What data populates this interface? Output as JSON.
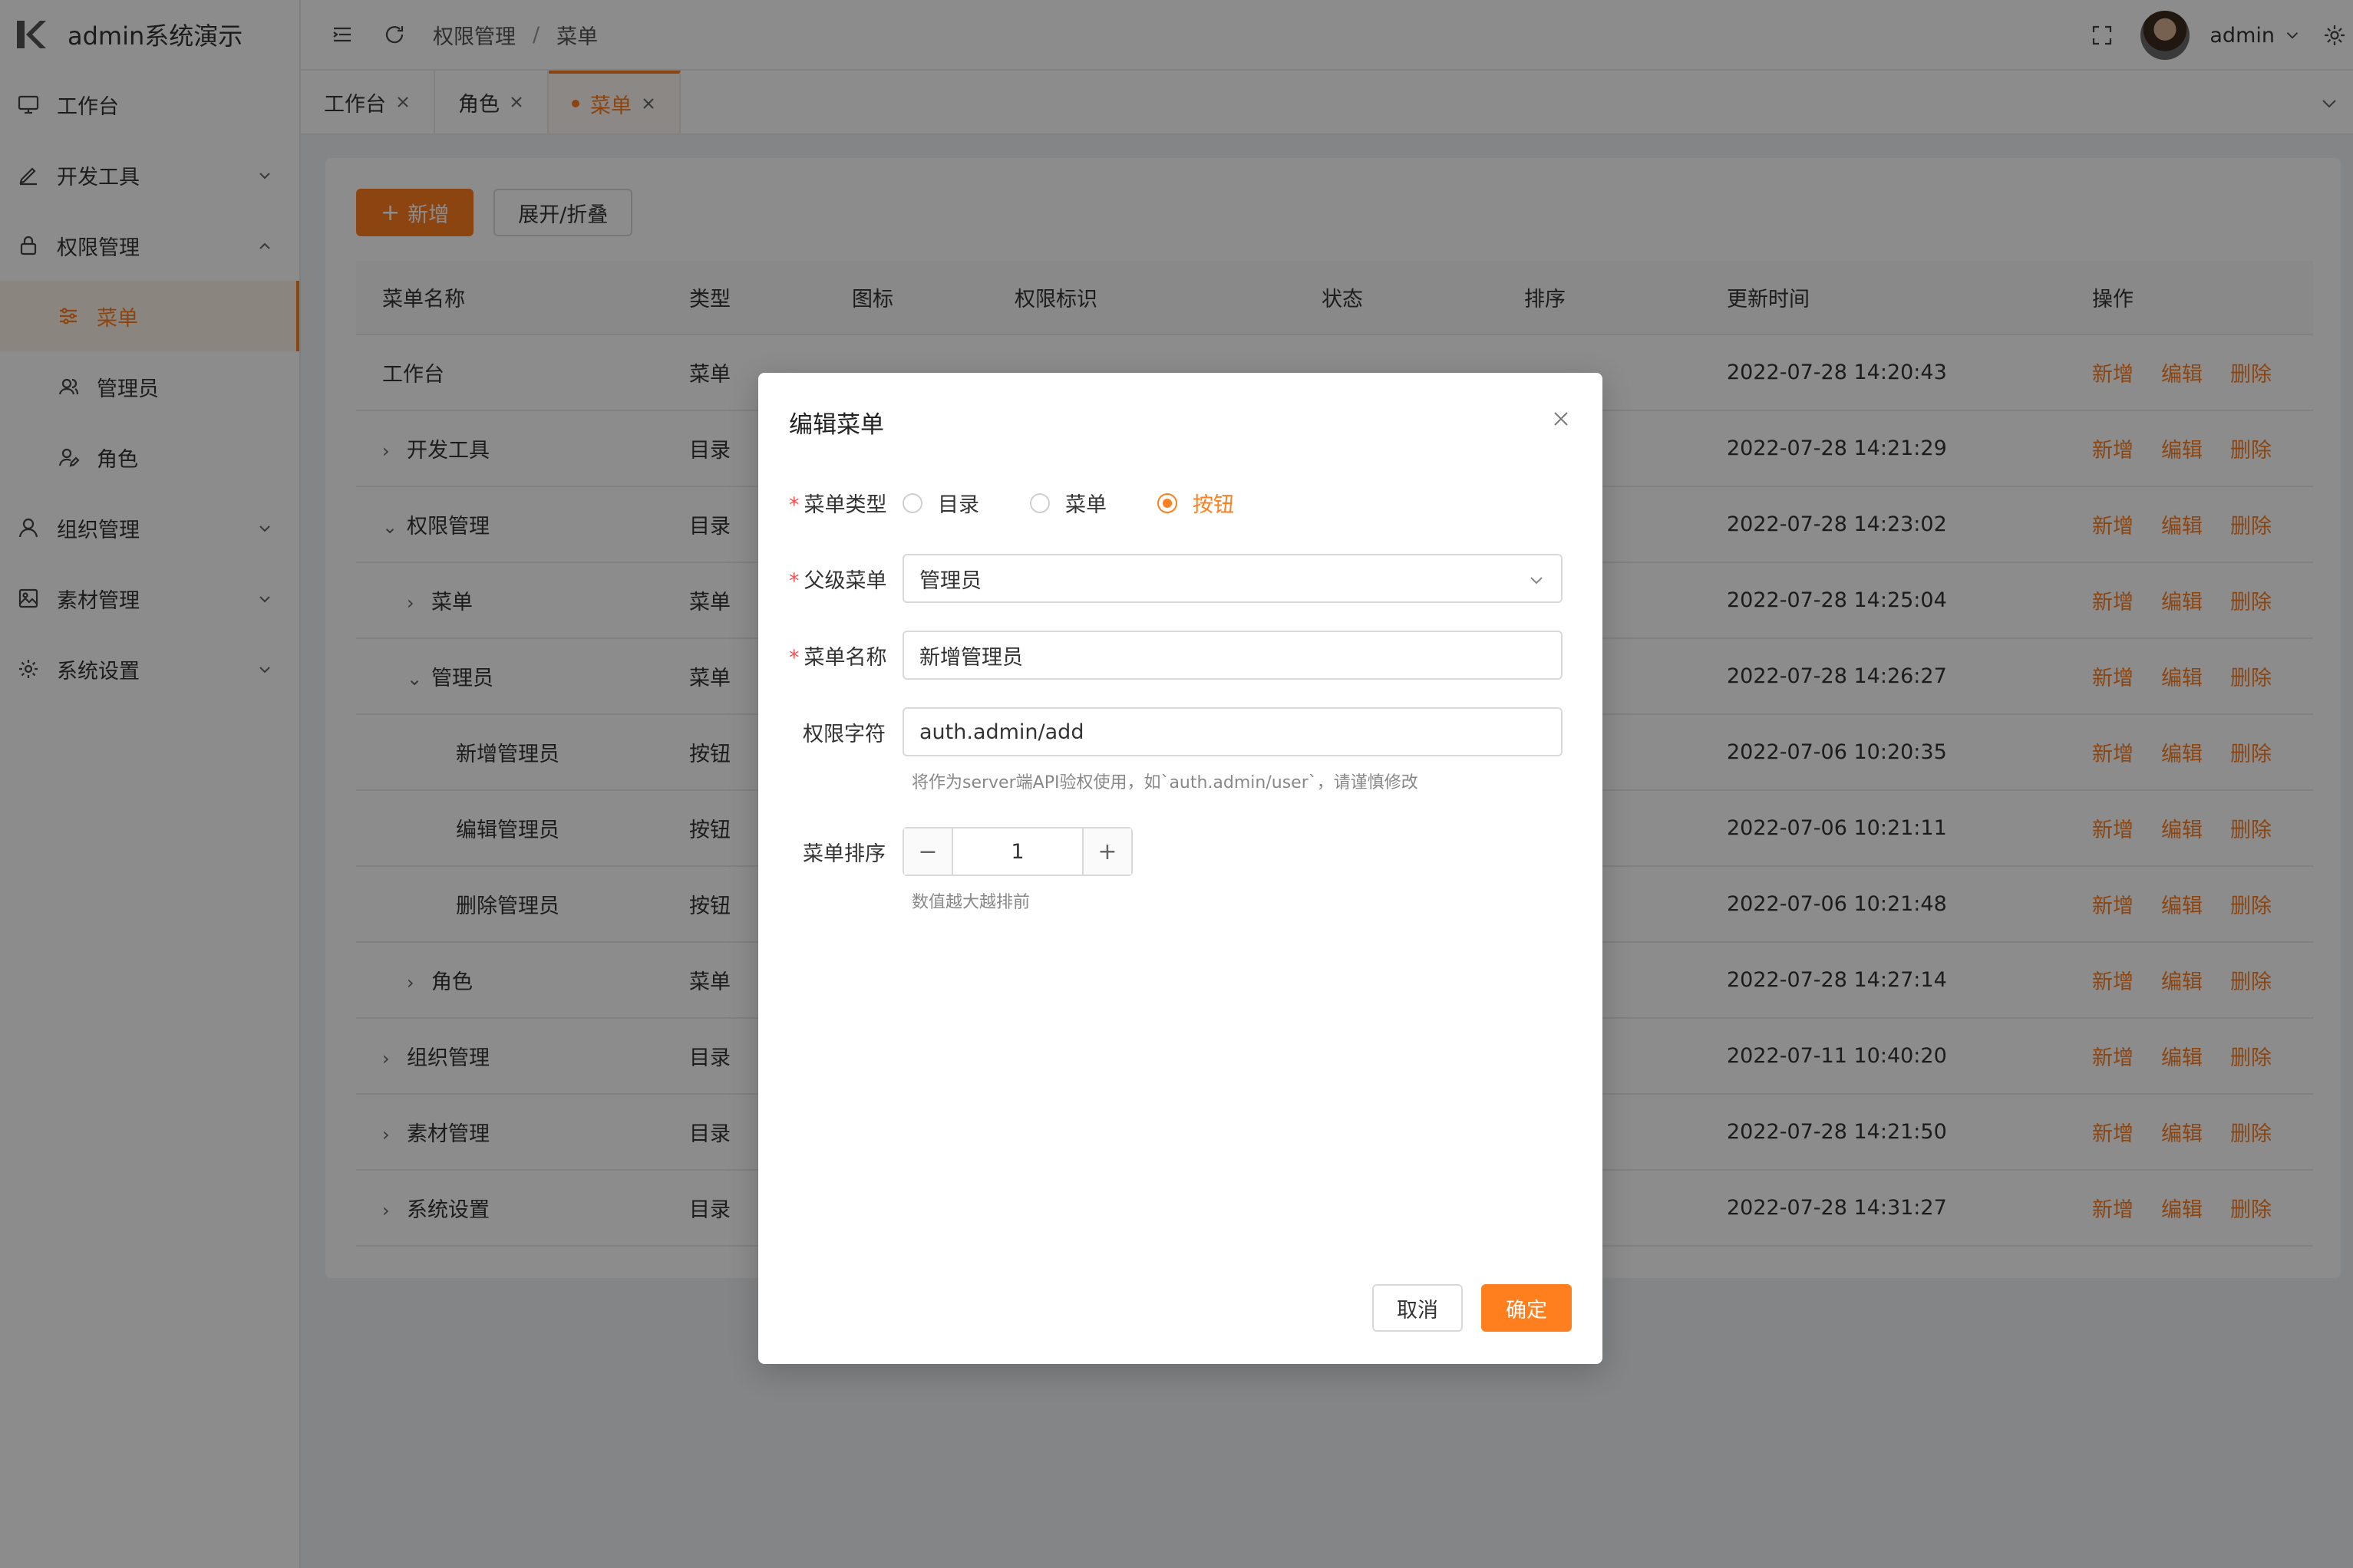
{
  "app": {
    "title": "admin系统演示"
  },
  "sidebar": {
    "items": [
      {
        "label": "工作台",
        "icon": "monitor-icon"
      },
      {
        "label": "开发工具",
        "icon": "pen-icon"
      },
      {
        "label": "权限管理",
        "icon": "lock-icon"
      },
      {
        "label": "菜单",
        "icon": "sliders-icon"
      },
      {
        "label": "管理员",
        "icon": "user-group-icon"
      },
      {
        "label": "角色",
        "icon": "user-edit-icon"
      },
      {
        "label": "组织管理",
        "icon": "user-icon"
      },
      {
        "label": "素材管理",
        "icon": "image-icon"
      },
      {
        "label": "系统设置",
        "icon": "gear-icon"
      }
    ]
  },
  "header": {
    "breadcrumb": [
      "权限管理",
      "菜单"
    ],
    "breadcrumb_sep": "/",
    "username": "admin"
  },
  "tabs": [
    {
      "label": "工作台"
    },
    {
      "label": "角色"
    },
    {
      "label": "菜单"
    }
  ],
  "toolbar": {
    "add_label": "新增",
    "toggle_label": "展开/折叠"
  },
  "table": {
    "columns": [
      "菜单名称",
      "类型",
      "图标",
      "权限标识",
      "状态",
      "排序",
      "更新时间",
      "操作"
    ],
    "actions": [
      "新增",
      "编辑",
      "删除"
    ],
    "rows": [
      {
        "name": "工作台",
        "type": "菜单",
        "time": "2022-07-28 14:20:43"
      },
      {
        "name": "开发工具",
        "type": "目录",
        "time": "2022-07-28 14:21:29"
      },
      {
        "name": "权限管理",
        "type": "目录",
        "time": "2022-07-28 14:23:02"
      },
      {
        "name": "菜单",
        "type": "菜单",
        "time": "2022-07-28 14:25:04"
      },
      {
        "name": "管理员",
        "type": "菜单",
        "time": "2022-07-28 14:26:27"
      },
      {
        "name": "新增管理员",
        "type": "按钮",
        "time": "2022-07-06 10:20:35"
      },
      {
        "name": "编辑管理员",
        "type": "按钮",
        "time": "2022-07-06 10:21:11"
      },
      {
        "name": "删除管理员",
        "type": "按钮",
        "time": "2022-07-06 10:21:48"
      },
      {
        "name": "角色",
        "type": "菜单",
        "time": "2022-07-28 14:27:14"
      },
      {
        "name": "组织管理",
        "type": "目录",
        "time": "2022-07-11 10:40:20"
      },
      {
        "name": "素材管理",
        "type": "目录",
        "time": "2022-07-28 14:21:50"
      },
      {
        "name": "系统设置",
        "type": "目录",
        "time": "2022-07-28 14:31:27"
      }
    ]
  },
  "modal": {
    "title": "编辑菜单",
    "type_label": "菜单类型",
    "type_options": [
      "目录",
      "菜单",
      "按钮"
    ],
    "type_selected": "按钮",
    "parent_label": "父级菜单",
    "parent_value": "管理员",
    "name_label": "菜单名称",
    "name_value": "新增管理员",
    "perm_label": "权限字符",
    "perm_value": "auth.admin/add",
    "perm_hint": "将作为server端API验权使用，如`auth.admin/user`，请谨慎修改",
    "order_label": "菜单排序",
    "order_value": "1",
    "order_hint": "数值越大越排前",
    "cancel_label": "取消",
    "ok_label": "确定"
  },
  "colors": {
    "accent": "#ff7f1f",
    "required": "#ff4d4f"
  }
}
